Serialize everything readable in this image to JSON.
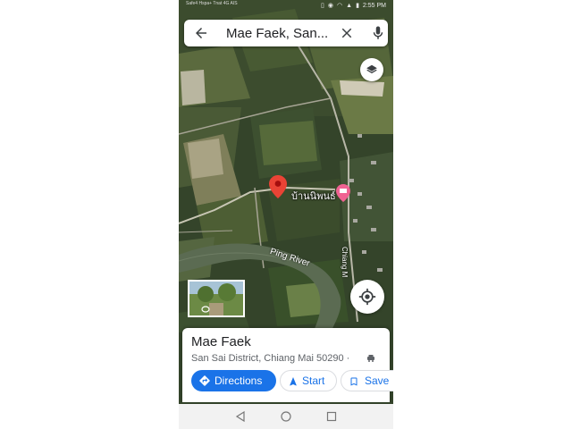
{
  "status_bar": {
    "carrier": "Safe4 Hspa+ Tnat 4G\nAIS",
    "time": "2:55 PM"
  },
  "search": {
    "query": "Mae Faek, San...",
    "icons": [
      "back-arrow-icon",
      "close-icon",
      "mic-icon"
    ]
  },
  "map": {
    "place_label": "บ้านนิพนธ์",
    "river_label": "Ping River",
    "road_label": "Chiang M",
    "colors": {
      "pin": "#ea4335",
      "poi": "#f06292",
      "river": "#5b6b52"
    }
  },
  "place_sheet": {
    "title": "Mae Faek",
    "subtitle": "San Sai District, Chiang Mai 50290 ·",
    "buttons": {
      "directions": "Directions",
      "start": "Start",
      "save": "Save"
    },
    "accent": "#1a73e8"
  },
  "nav_bar": {
    "icons": [
      "back-triangle-icon",
      "home-circle-icon",
      "recents-square-icon"
    ]
  }
}
